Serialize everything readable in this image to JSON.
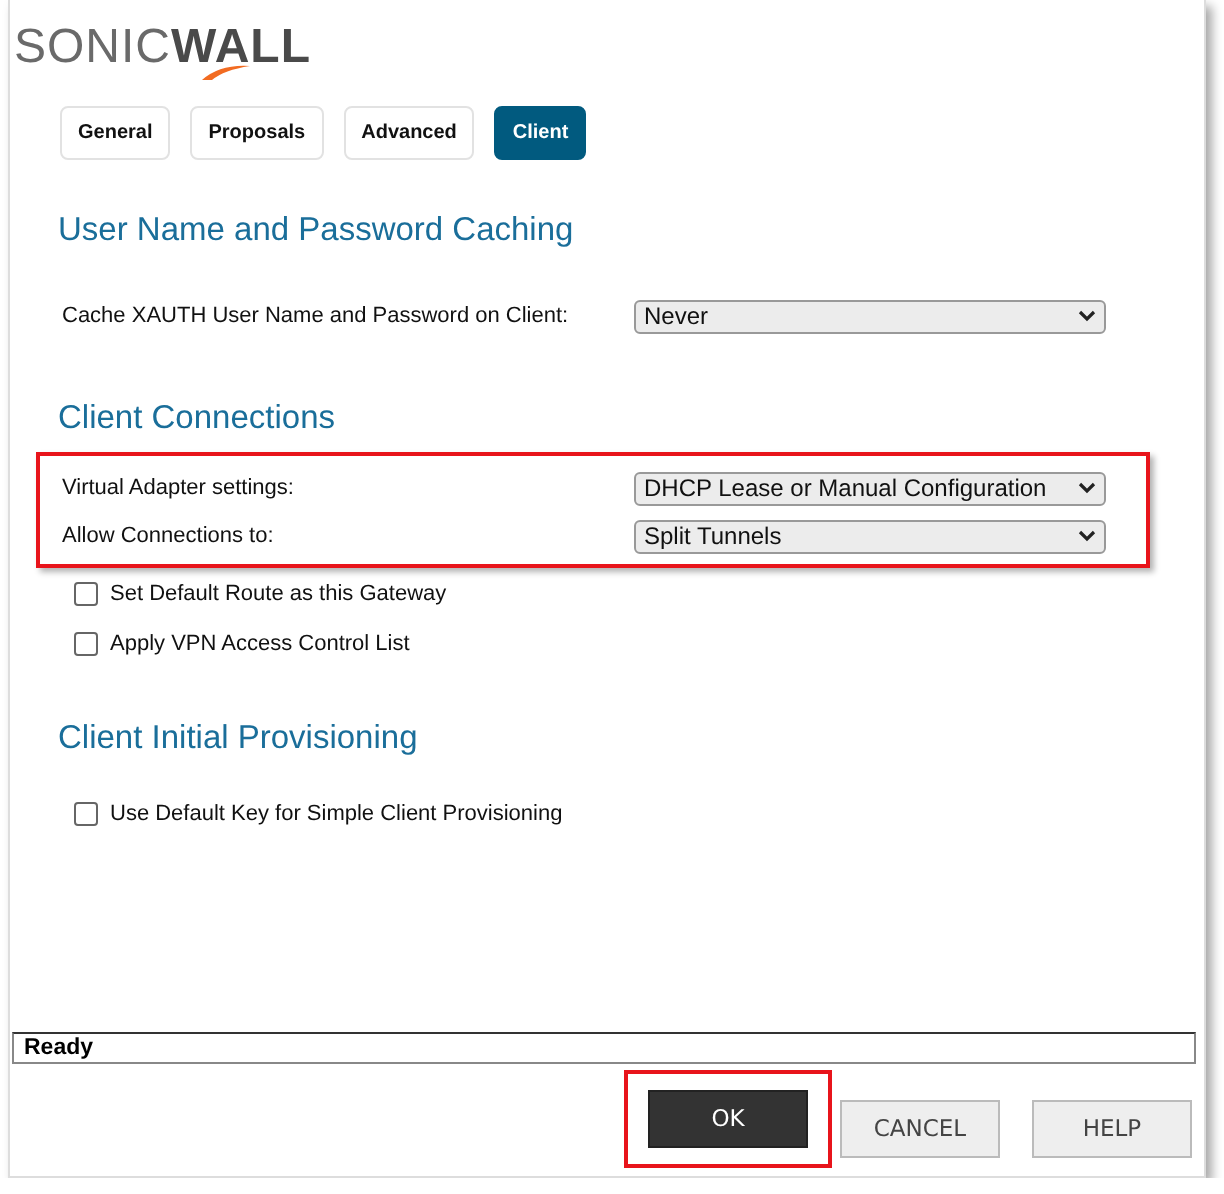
{
  "logo": {
    "part_1": "SONIC",
    "part_2": "WALL"
  },
  "tabs": [
    {
      "label": "General",
      "selected": false
    },
    {
      "label": "Proposals",
      "selected": false
    },
    {
      "label": "Advanced",
      "selected": false
    },
    {
      "label": "Client",
      "selected": true
    }
  ],
  "sections": [
    {
      "title": "User Name and Password Caching",
      "items": [
        {
          "kind": "select",
          "label": "Cache XAUTH User Name and Password on Client:",
          "value": "Never",
          "highlighted": false
        }
      ]
    },
    {
      "title": "Client Connections",
      "items": [
        {
          "kind": "select",
          "label": "Virtual Adapter settings:",
          "value": "DHCP Lease or Manual Configuration",
          "highlighted": true
        },
        {
          "kind": "select",
          "label": "Allow Connections to:",
          "value": "Split Tunnels",
          "highlighted": true
        },
        {
          "kind": "checkbox",
          "label": "Set Default Route as this Gateway",
          "checked": false
        },
        {
          "kind": "checkbox",
          "label": "Apply VPN Access Control List",
          "checked": false
        }
      ]
    },
    {
      "title": "Client Initial Provisioning",
      "items": [
        {
          "kind": "checkbox",
          "label": "Use Default Key for Simple Client Provisioning",
          "checked": false
        }
      ]
    }
  ],
  "status_bar": "Ready",
  "buttons": [
    {
      "label": "OK",
      "primary": true,
      "highlighted": true
    },
    {
      "label": "CANCEL",
      "primary": false,
      "highlighted": false
    },
    {
      "label": "HELP",
      "primary": false,
      "highlighted": false
    }
  ]
}
